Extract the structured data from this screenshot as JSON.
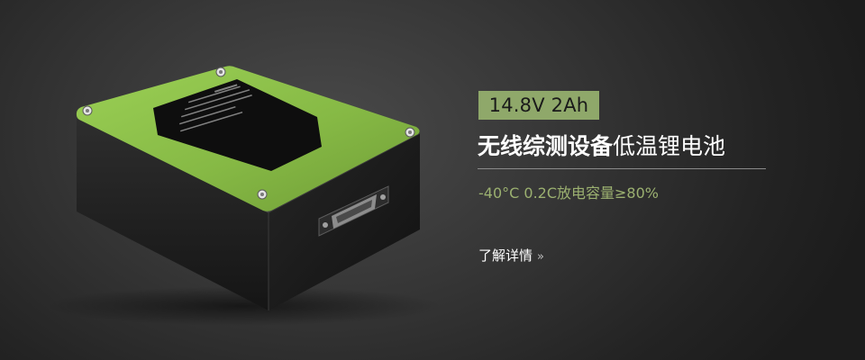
{
  "banner": {
    "spec_tag": "14.8V 2Ah",
    "headline_bold": "无线综测设备",
    "headline_rest": "低温锂电池",
    "subline": "-40°C 0.2C放电容量≥80%",
    "more_link": "了解详情",
    "more_link_icon": "double-chevron-right-icon",
    "colors": {
      "accent_green": "#8fa86a",
      "accent_text": "#9bb070",
      "background": "#353535",
      "battery_top": "#8ec04a"
    }
  }
}
